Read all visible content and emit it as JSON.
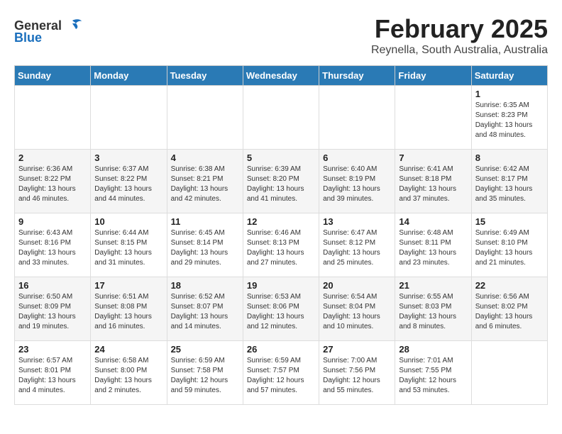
{
  "logo": {
    "general": "General",
    "blue": "Blue"
  },
  "header": {
    "title": "February 2025",
    "subtitle": "Reynella, South Australia, Australia"
  },
  "weekdays": [
    "Sunday",
    "Monday",
    "Tuesday",
    "Wednesday",
    "Thursday",
    "Friday",
    "Saturday"
  ],
  "weeks": [
    [
      {
        "day": "",
        "info": ""
      },
      {
        "day": "",
        "info": ""
      },
      {
        "day": "",
        "info": ""
      },
      {
        "day": "",
        "info": ""
      },
      {
        "day": "",
        "info": ""
      },
      {
        "day": "",
        "info": ""
      },
      {
        "day": "1",
        "info": "Sunrise: 6:35 AM\nSunset: 8:23 PM\nDaylight: 13 hours\nand 48 minutes."
      }
    ],
    [
      {
        "day": "2",
        "info": "Sunrise: 6:36 AM\nSunset: 8:22 PM\nDaylight: 13 hours\nand 46 minutes."
      },
      {
        "day": "3",
        "info": "Sunrise: 6:37 AM\nSunset: 8:22 PM\nDaylight: 13 hours\nand 44 minutes."
      },
      {
        "day": "4",
        "info": "Sunrise: 6:38 AM\nSunset: 8:21 PM\nDaylight: 13 hours\nand 42 minutes."
      },
      {
        "day": "5",
        "info": "Sunrise: 6:39 AM\nSunset: 8:20 PM\nDaylight: 13 hours\nand 41 minutes."
      },
      {
        "day": "6",
        "info": "Sunrise: 6:40 AM\nSunset: 8:19 PM\nDaylight: 13 hours\nand 39 minutes."
      },
      {
        "day": "7",
        "info": "Sunrise: 6:41 AM\nSunset: 8:18 PM\nDaylight: 13 hours\nand 37 minutes."
      },
      {
        "day": "8",
        "info": "Sunrise: 6:42 AM\nSunset: 8:17 PM\nDaylight: 13 hours\nand 35 minutes."
      }
    ],
    [
      {
        "day": "9",
        "info": "Sunrise: 6:43 AM\nSunset: 8:16 PM\nDaylight: 13 hours\nand 33 minutes."
      },
      {
        "day": "10",
        "info": "Sunrise: 6:44 AM\nSunset: 8:15 PM\nDaylight: 13 hours\nand 31 minutes."
      },
      {
        "day": "11",
        "info": "Sunrise: 6:45 AM\nSunset: 8:14 PM\nDaylight: 13 hours\nand 29 minutes."
      },
      {
        "day": "12",
        "info": "Sunrise: 6:46 AM\nSunset: 8:13 PM\nDaylight: 13 hours\nand 27 minutes."
      },
      {
        "day": "13",
        "info": "Sunrise: 6:47 AM\nSunset: 8:12 PM\nDaylight: 13 hours\nand 25 minutes."
      },
      {
        "day": "14",
        "info": "Sunrise: 6:48 AM\nSunset: 8:11 PM\nDaylight: 13 hours\nand 23 minutes."
      },
      {
        "day": "15",
        "info": "Sunrise: 6:49 AM\nSunset: 8:10 PM\nDaylight: 13 hours\nand 21 minutes."
      }
    ],
    [
      {
        "day": "16",
        "info": "Sunrise: 6:50 AM\nSunset: 8:09 PM\nDaylight: 13 hours\nand 19 minutes."
      },
      {
        "day": "17",
        "info": "Sunrise: 6:51 AM\nSunset: 8:08 PM\nDaylight: 13 hours\nand 16 minutes."
      },
      {
        "day": "18",
        "info": "Sunrise: 6:52 AM\nSunset: 8:07 PM\nDaylight: 13 hours\nand 14 minutes."
      },
      {
        "day": "19",
        "info": "Sunrise: 6:53 AM\nSunset: 8:06 PM\nDaylight: 13 hours\nand 12 minutes."
      },
      {
        "day": "20",
        "info": "Sunrise: 6:54 AM\nSunset: 8:04 PM\nDaylight: 13 hours\nand 10 minutes."
      },
      {
        "day": "21",
        "info": "Sunrise: 6:55 AM\nSunset: 8:03 PM\nDaylight: 13 hours\nand 8 minutes."
      },
      {
        "day": "22",
        "info": "Sunrise: 6:56 AM\nSunset: 8:02 PM\nDaylight: 13 hours\nand 6 minutes."
      }
    ],
    [
      {
        "day": "23",
        "info": "Sunrise: 6:57 AM\nSunset: 8:01 PM\nDaylight: 13 hours\nand 4 minutes."
      },
      {
        "day": "24",
        "info": "Sunrise: 6:58 AM\nSunset: 8:00 PM\nDaylight: 13 hours\nand 2 minutes."
      },
      {
        "day": "25",
        "info": "Sunrise: 6:59 AM\nSunset: 7:58 PM\nDaylight: 12 hours\nand 59 minutes."
      },
      {
        "day": "26",
        "info": "Sunrise: 6:59 AM\nSunset: 7:57 PM\nDaylight: 12 hours\nand 57 minutes."
      },
      {
        "day": "27",
        "info": "Sunrise: 7:00 AM\nSunset: 7:56 PM\nDaylight: 12 hours\nand 55 minutes."
      },
      {
        "day": "28",
        "info": "Sunrise: 7:01 AM\nSunset: 7:55 PM\nDaylight: 12 hours\nand 53 minutes."
      },
      {
        "day": "",
        "info": ""
      }
    ]
  ]
}
